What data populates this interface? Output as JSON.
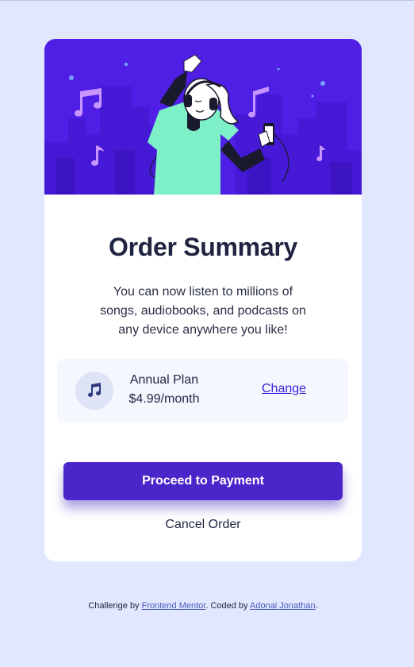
{
  "colors": {
    "page_background": "#e0e7ff",
    "hero_background": "#4f1fe6",
    "primary_button": "#4a25c9",
    "plan_box": "#f5f7ff",
    "link": "#3b1fd6"
  },
  "hero": {
    "illustration": "person-dancing-with-headphones-illustration"
  },
  "order": {
    "title": "Order Summary",
    "description": "You can now listen to millions of songs, audiobooks, and podcasts on any device anywhere you like!"
  },
  "plan": {
    "icon": "music-note-icon",
    "name": "Annual Plan",
    "price": "$4.99/month",
    "change_label": "Change"
  },
  "actions": {
    "proceed_label": "Proceed to Payment",
    "cancel_label": "Cancel Order"
  },
  "footer": {
    "challenge_prefix": "Challenge by ",
    "challenge_link": "Frontend Mentor",
    "coded_prefix": ". Coded by ",
    "author_link": "Adonai Jonathan",
    "suffix": "."
  }
}
